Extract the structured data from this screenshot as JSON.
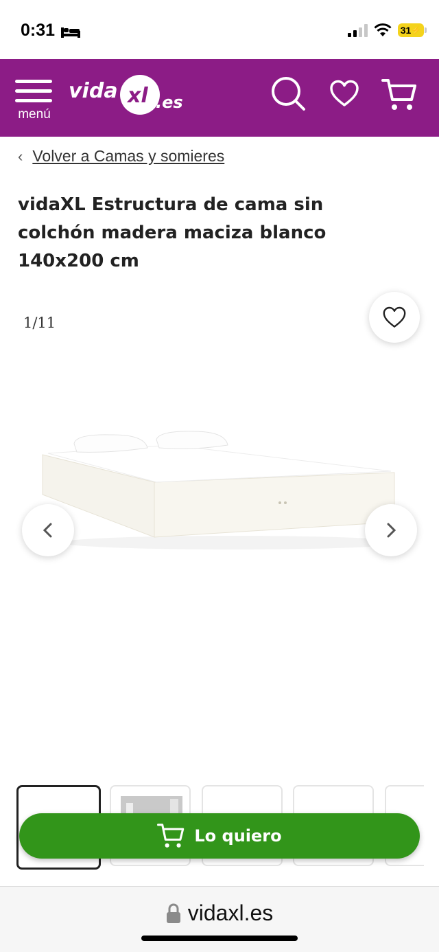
{
  "status_bar": {
    "time": "0:31",
    "battery": "31"
  },
  "header": {
    "menu_label": "menú",
    "logo_text_left": "vida",
    "logo_text_xl": "xl",
    "logo_text_domain": ".es",
    "brand_color": "#8c1c86"
  },
  "breadcrumb": {
    "label": "Volver a Camas y somieres"
  },
  "product": {
    "title": "vidaXL Estructura de cama sin colchón madera maciza blanco 140x200 cm",
    "image_counter": "1/11"
  },
  "cta": {
    "label": "Lo quiero",
    "color": "#32951a"
  },
  "browser": {
    "url": "vidaxl.es"
  },
  "icons": [
    "sleep-icon",
    "signal-icon",
    "wifi-icon",
    "battery-icon",
    "menu-icon",
    "search-icon",
    "heart-icon",
    "cart-icon",
    "chevron-left-icon",
    "chevron-right-icon",
    "lock-icon"
  ]
}
